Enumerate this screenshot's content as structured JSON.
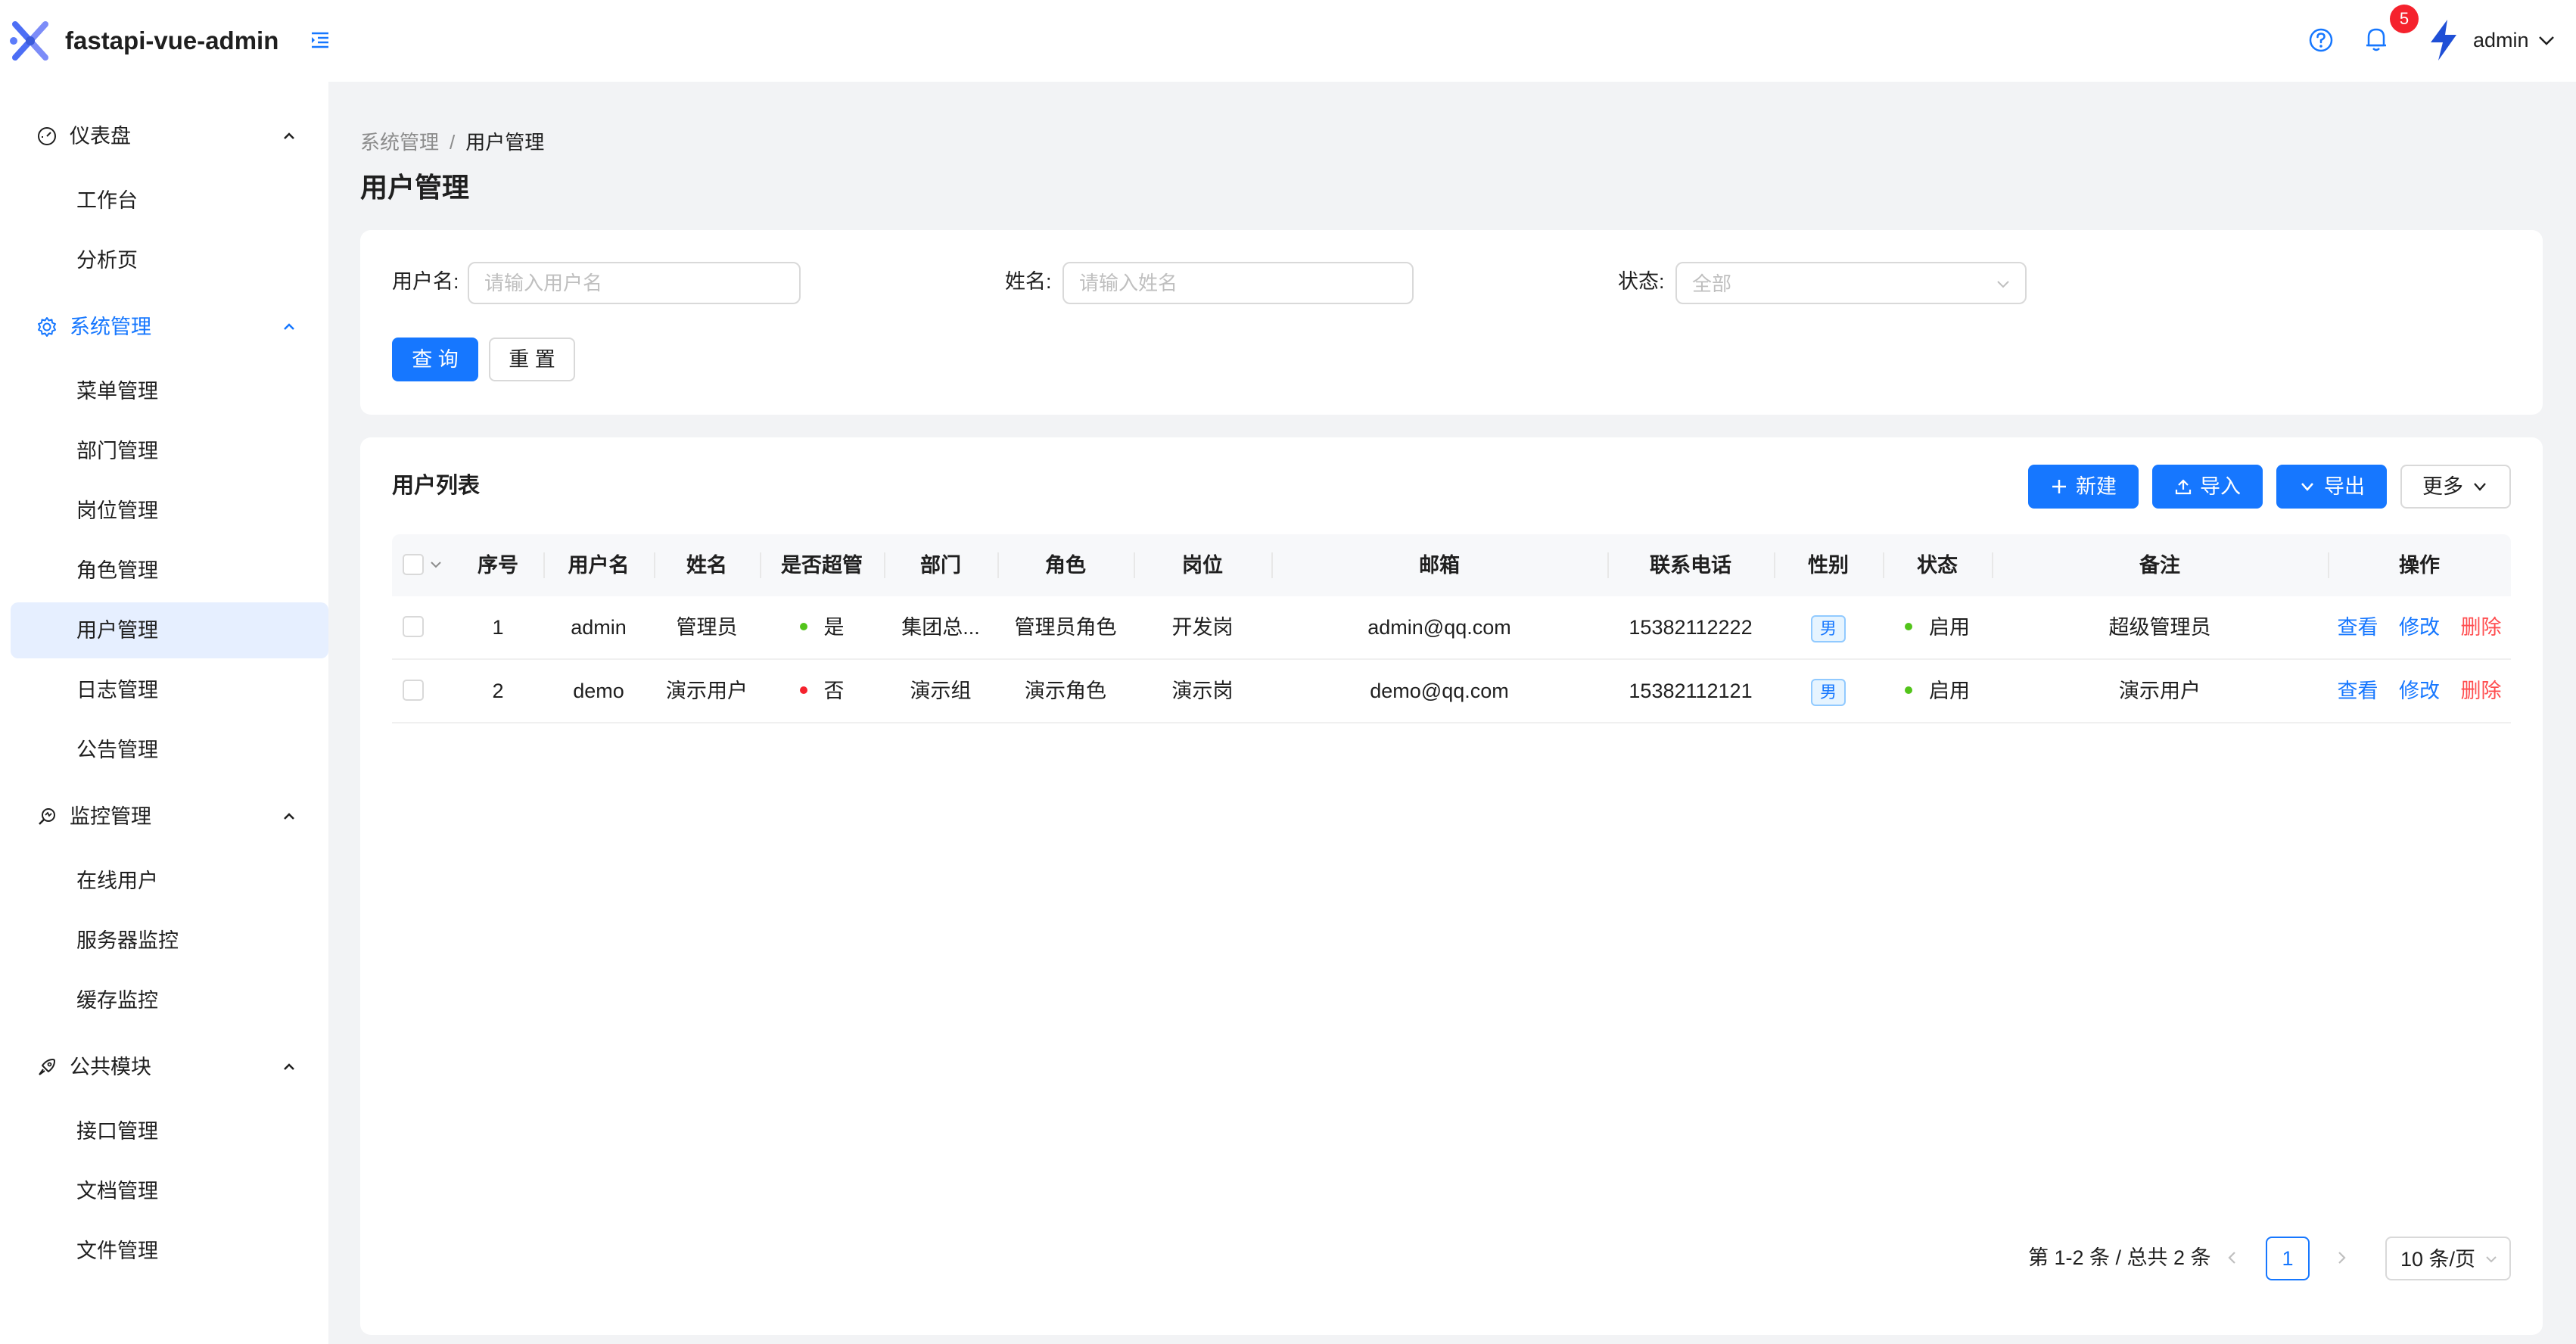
{
  "header": {
    "app_title": "fastapi-vue-admin",
    "notification_count": "5",
    "username": "admin"
  },
  "sidebar": {
    "groups": [
      {
        "label": "仪表盘",
        "icon": "dashboard-icon",
        "items": [
          {
            "label": "工作台"
          },
          {
            "label": "分析页"
          }
        ]
      },
      {
        "label": "系统管理",
        "icon": "gear-icon",
        "items": [
          {
            "label": "菜单管理"
          },
          {
            "label": "部门管理"
          },
          {
            "label": "岗位管理"
          },
          {
            "label": "角色管理"
          },
          {
            "label": "用户管理"
          },
          {
            "label": "日志管理"
          },
          {
            "label": "公告管理"
          }
        ]
      },
      {
        "label": "监控管理",
        "icon": "monitor-icon",
        "items": [
          {
            "label": "在线用户"
          },
          {
            "label": "服务器监控"
          },
          {
            "label": "缓存监控"
          }
        ]
      },
      {
        "label": "公共模块",
        "icon": "rocket-icon",
        "items": [
          {
            "label": "接口管理"
          },
          {
            "label": "文档管理"
          },
          {
            "label": "文件管理"
          }
        ]
      }
    ]
  },
  "breadcrumb": {
    "parent": "系统管理",
    "separator": "/",
    "current": "用户管理"
  },
  "page_title": "用户管理",
  "search": {
    "username_label": "用户名:",
    "username_placeholder": "请输入用户名",
    "name_label": "姓名:",
    "name_placeholder": "请输入姓名",
    "status_label": "状态:",
    "status_value": "全部",
    "query_button": "查 询",
    "reset_button": "重 置"
  },
  "list": {
    "title": "用户列表",
    "new_button": "新建",
    "import_button": "导入",
    "export_button": "导出",
    "more_button": "更多",
    "columns": [
      "序号",
      "用户名",
      "姓名",
      "是否超管",
      "部门",
      "角色",
      "岗位",
      "邮箱",
      "联系电话",
      "性别",
      "状态",
      "备注",
      "操作"
    ],
    "rows": [
      {
        "index": "1",
        "username": "admin",
        "name": "管理员",
        "is_super": "是",
        "super_color": "#52c41a",
        "dept": "集团总...",
        "role": "管理员角色",
        "post": "开发岗",
        "email": "admin@qq.com",
        "phone": "15382112222",
        "gender": "男",
        "status": "启用",
        "remark": "超级管理员"
      },
      {
        "index": "2",
        "username": "demo",
        "name": "演示用户",
        "is_super": "否",
        "super_color": "#f5222d",
        "dept": "演示组",
        "role": "演示角色",
        "post": "演示岗",
        "email": "demo@qq.com",
        "phone": "15382112121",
        "gender": "男",
        "status": "启用",
        "remark": "演示用户"
      }
    ],
    "actions": {
      "view": "查看",
      "edit": "修改",
      "delete": "删除"
    }
  },
  "pagination": {
    "total_text": "第 1-2 条 / 总共 2 条",
    "current_page": "1",
    "page_size": "10 条/页"
  },
  "colors": {
    "primary": "#1677ff",
    "danger": "#ff4d4f",
    "enabled": "#52c41a"
  }
}
